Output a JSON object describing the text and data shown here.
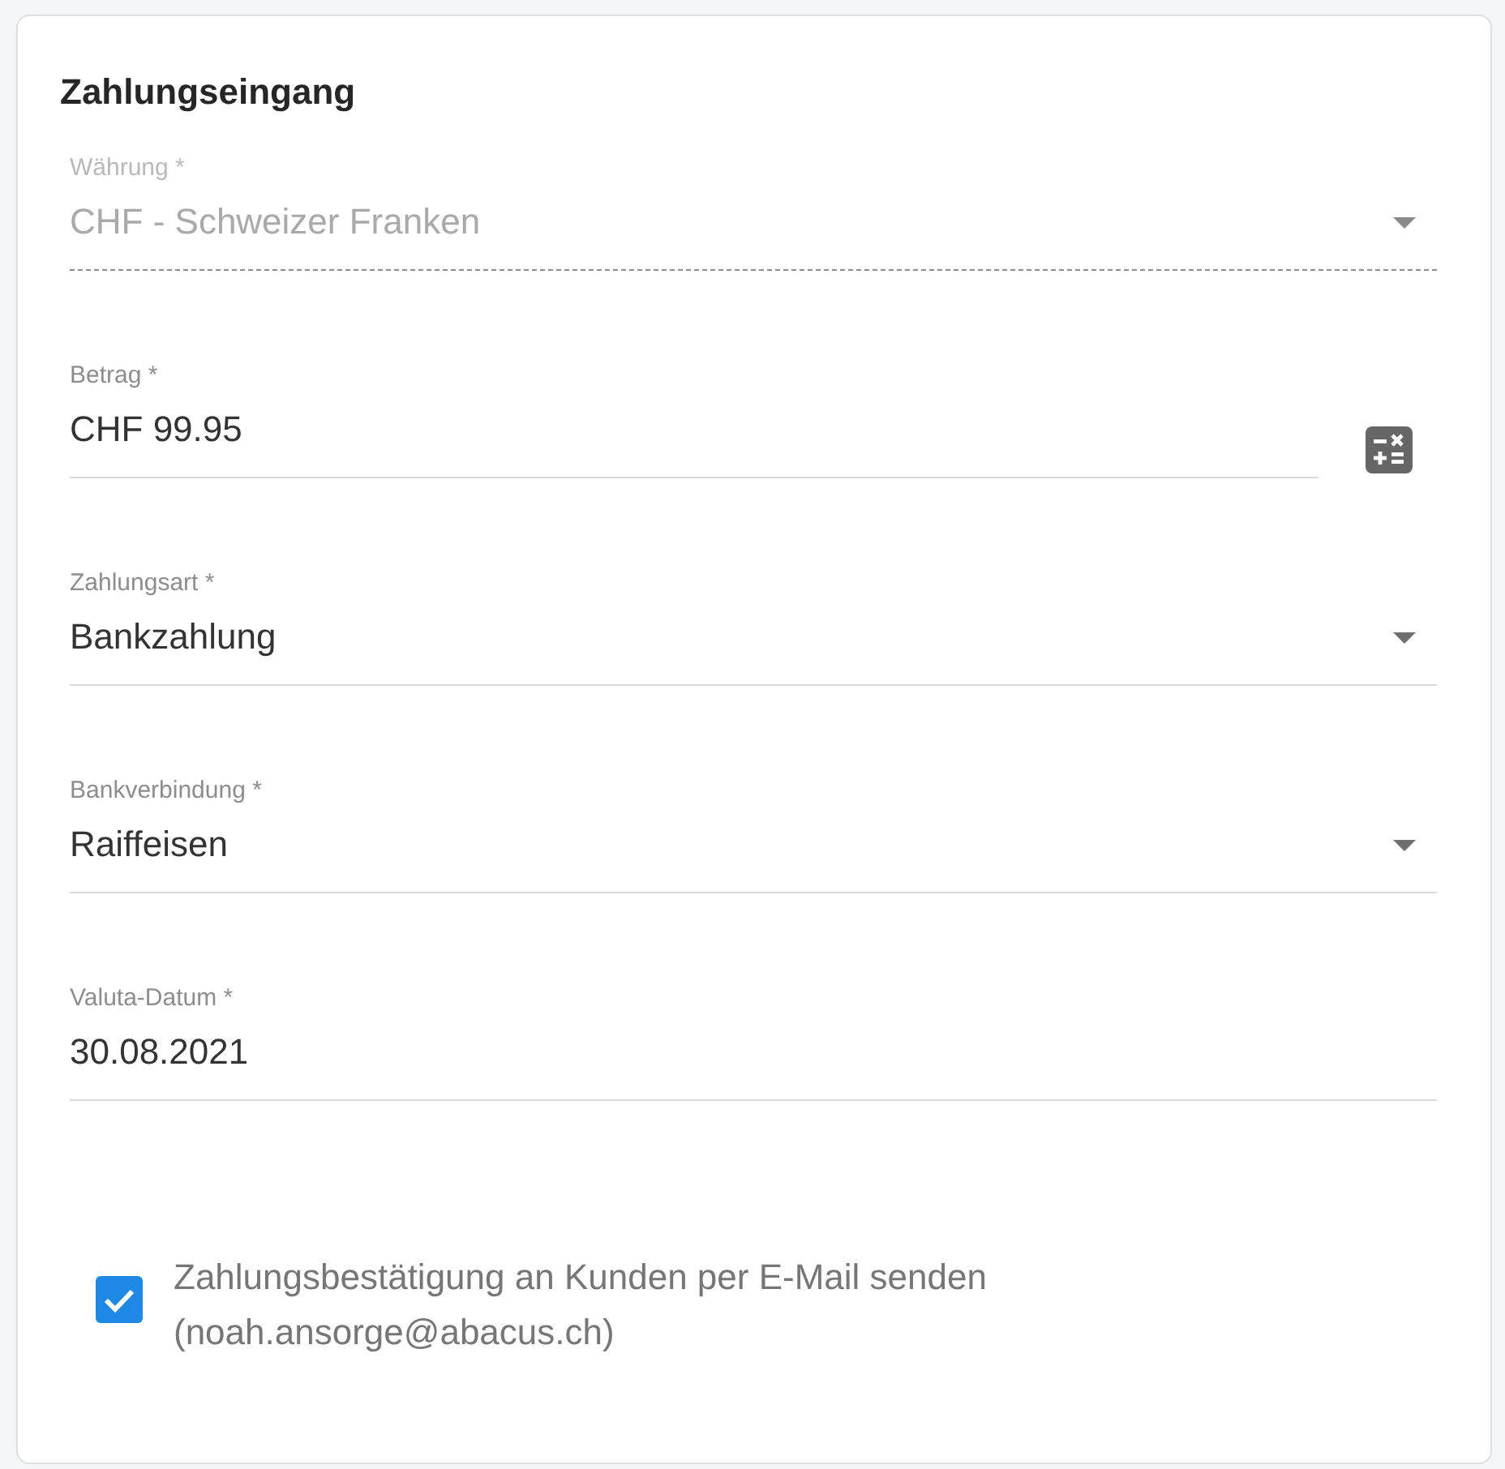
{
  "title": "Zahlungseingang",
  "fields": [
    {
      "kind": "select",
      "label": "Währung *",
      "value": "CHF - Schweizer Franken",
      "disabled": true
    },
    {
      "kind": "amount",
      "label": "Betrag *",
      "value": "CHF 99.95",
      "disabled": false
    },
    {
      "kind": "select",
      "label": "Zahlungsart *",
      "value": "Bankzahlung",
      "disabled": false
    },
    {
      "kind": "select",
      "label": "Bankverbindung *",
      "value": "Raiffeisen",
      "disabled": false
    },
    {
      "kind": "text",
      "label": "Valuta-Datum *",
      "value": "30.08.2021",
      "disabled": false
    }
  ],
  "confirmation": {
    "checked": true,
    "label": "Zahlungsbestätigung an Kunden per E-Mail senden",
    "email": "(noah.ansorge@abacus.ch)"
  }
}
